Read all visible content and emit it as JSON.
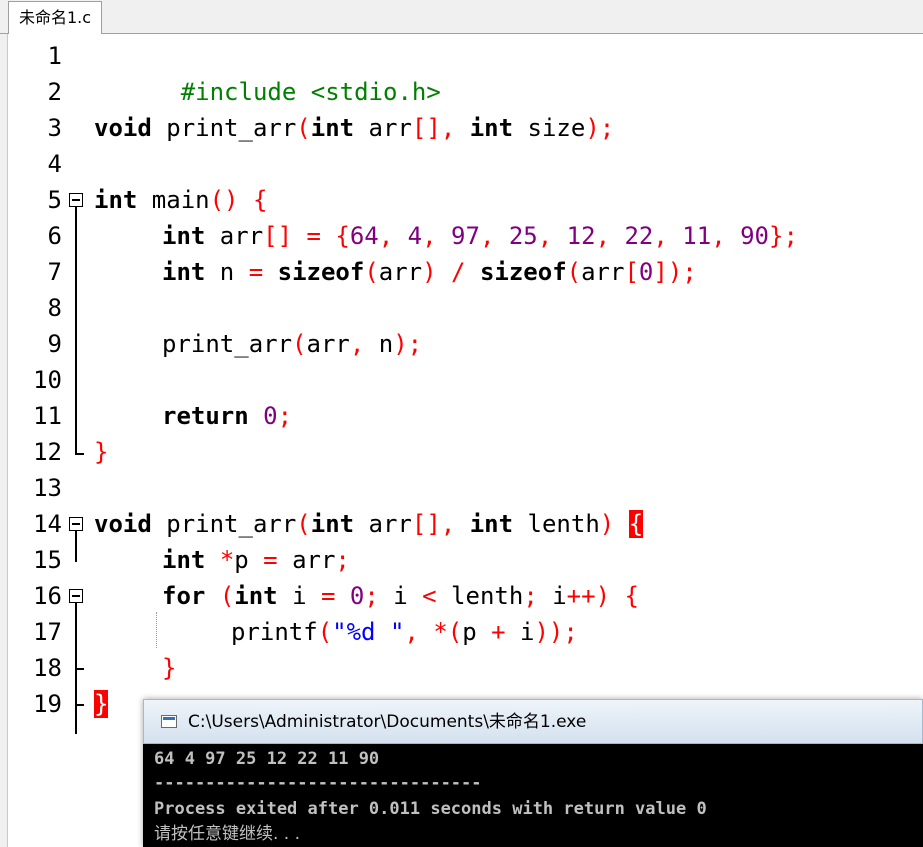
{
  "tab": {
    "label": "未命名1.c"
  },
  "line_numbers": [
    "1",
    "2",
    "3",
    "4",
    "5",
    "6",
    "7",
    "8",
    "9",
    "10",
    "11",
    "12",
    "13",
    "14",
    "15",
    "16",
    "17",
    "18",
    "19"
  ],
  "code": {
    "l1": {
      "directive": "#include <stdio.h>"
    },
    "l3": {
      "t1": "void",
      "t2": " print_arr",
      "t3": "(",
      "t4": "int",
      "t5": " arr",
      "t6": "[],",
      "t7": " ",
      "t8": "int",
      "t9": " size",
      "t10": ");"
    },
    "l5": {
      "t1": "int",
      "t2": " main",
      "t3": "()",
      "t4": " ",
      "t5": "{"
    },
    "l6": {
      "t1": "int",
      "t2": " arr",
      "t3": "[]",
      "t4": " = {",
      "t5": "64",
      "t6": ", ",
      "t7": "4",
      "t8": ", ",
      "t9": "97",
      "t10": ", ",
      "t11": "25",
      "t12": ", ",
      "t13": "12",
      "t14": ", ",
      "t15": "22",
      "t16": ", ",
      "t17": "11",
      "t18": ", ",
      "t19": "90",
      "t20": "};"
    },
    "l7": {
      "t1": "int",
      "t2": " n ",
      "t3": "=",
      "t4": " ",
      "t5": "sizeof",
      "t6": "(",
      "t7": "arr",
      "t8": ")",
      "t9": " / ",
      "t10": "sizeof",
      "t11": "(",
      "t12": "arr",
      "t13": "[",
      "t14": "0",
      "t15": "]);"
    },
    "l9": {
      "t1": "print_arr",
      "t2": "(",
      "t3": "arr",
      "t4": ",",
      "t5": " n",
      "t6": ");"
    },
    "l11": {
      "t1": "return",
      "t2": " ",
      "t3": "0",
      "t4": ";"
    },
    "l12": {
      "t1": "}"
    },
    "l14": {
      "t1": "void",
      "t2": " print_arr",
      "t3": "(",
      "t4": "int",
      "t5": " arr",
      "t6": "[],",
      "t7": " ",
      "t8": "int",
      "t9": " lenth",
      "t10": ")",
      "t11": " ",
      "t12": "{"
    },
    "l15": {
      "t1": "int",
      "t2": " ",
      "t3": "*",
      "t4": "p ",
      "t5": "=",
      "t6": " arr",
      "t7": ";"
    },
    "l16": {
      "t1": "for",
      "t2": " ",
      "t3": "(",
      "t4": "int",
      "t5": " i ",
      "t6": "=",
      "t7": " ",
      "t8": "0",
      "t9": ";",
      "t10": " i ",
      "t11": "<",
      "t12": " lenth",
      "t13": ";",
      "t14": " i",
      "t15": "++)",
      "t16": " ",
      "t17": "{"
    },
    "l17": {
      "t1": "printf",
      "t2": "(",
      "t3": "\"%d \"",
      "t4": ",",
      "t5": " ",
      "t6": "*(",
      "t7": "p ",
      "t8": "+",
      "t9": " i",
      "t10": "));"
    },
    "l18": {
      "t1": "}"
    },
    "l19": {
      "t1": "}"
    }
  },
  "console": {
    "title": "C:\\Users\\Administrator\\Documents\\未命名1.exe",
    "output": "64 4 97 25 12 22 11 90",
    "separator": "--------------------------------",
    "exit_message": "Process exited after 0.011 seconds with return value 0",
    "press_any_key": "请按任意键继续. . ."
  },
  "colors": {
    "keyword": "#000000",
    "preprocessor": "#008000",
    "operator": "#ff0000",
    "number": "#800080",
    "string": "#0000ff",
    "brace_highlight": "#ff0000",
    "console_bg": "#000000",
    "console_text": "#c0c0c0"
  },
  "icons": {
    "fold_open": "minus-box-icon",
    "console_app": "console-window-icon"
  }
}
